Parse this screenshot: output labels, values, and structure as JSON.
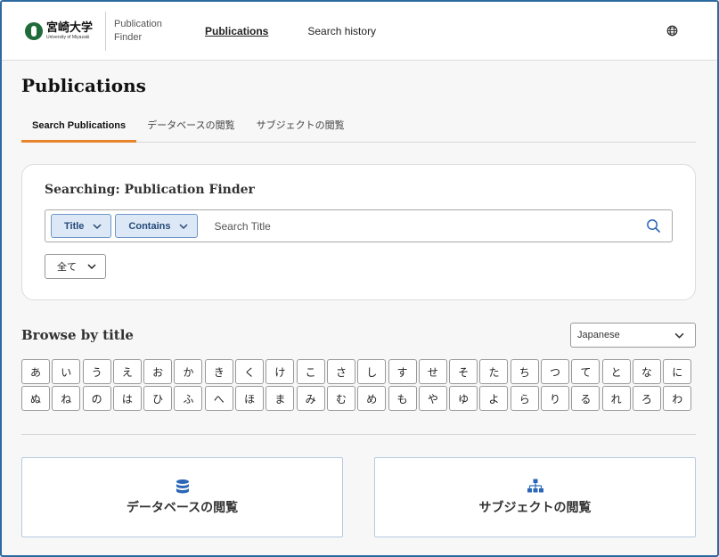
{
  "header": {
    "logo_jp": "宮崎大学",
    "logo_en": "University of Miyazaki",
    "product_line1": "Publication",
    "product_line2": "Finder",
    "nav": [
      {
        "label": "Publications"
      },
      {
        "label": "Search history"
      }
    ],
    "globe_icon": "globe-icon"
  },
  "page": {
    "title": "Publications",
    "tabs": [
      {
        "label": "Search Publications"
      },
      {
        "label": "データベースの閲覧"
      },
      {
        "label": "サブジェクトの閲覧"
      }
    ]
  },
  "search": {
    "heading": "Searching: Publication Finder",
    "field_label": "Title",
    "operator_label": "Contains",
    "placeholder": "Search Title",
    "scope_value": "全て"
  },
  "browse": {
    "title": "Browse by title",
    "language": "Japanese",
    "row1": [
      "あ",
      "い",
      "う",
      "え",
      "お",
      "か",
      "き",
      "く",
      "け",
      "こ",
      "さ",
      "し",
      "す",
      "せ",
      "そ",
      "た",
      "ち",
      "つ",
      "て",
      "と",
      "な",
      "に"
    ],
    "row2": [
      "ぬ",
      "ね",
      "の",
      "は",
      "ひ",
      "ふ",
      "へ",
      "ほ",
      "ま",
      "み",
      "む",
      "め",
      "も",
      "や",
      "ゆ",
      "よ",
      "ら",
      "り",
      "る",
      "れ",
      "ろ",
      "わ"
    ]
  },
  "cards": [
    {
      "label": "データベースの閲覧",
      "icon": "database-icon"
    },
    {
      "label": "サブジェクトの閲覧",
      "icon": "hierarchy-icon"
    }
  ],
  "colors": {
    "accent": "#e8842c",
    "pill_bg": "#dde8f6",
    "pill_text": "#254a78",
    "icon_blue": "#2b66b8"
  }
}
